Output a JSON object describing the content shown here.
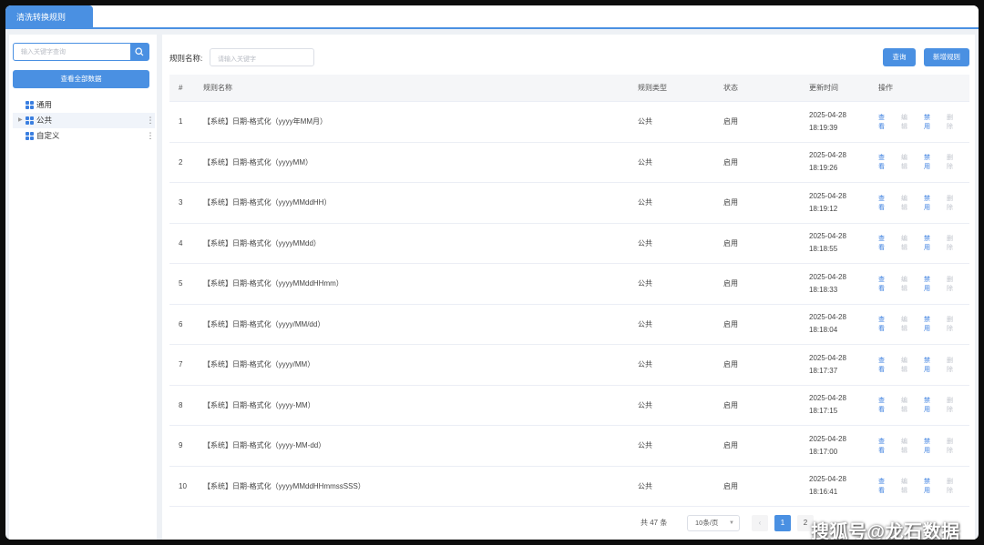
{
  "tab": {
    "title": "清洗转换规则"
  },
  "sidebar": {
    "search_placeholder": "输入关键字查询",
    "view_all_label": "查看全部数据",
    "tree": [
      {
        "label": "通用",
        "has_arrow": false,
        "has_menu": false
      },
      {
        "label": "公共",
        "has_arrow": true,
        "has_menu": true
      },
      {
        "label": "自定义",
        "has_arrow": false,
        "has_menu": true
      }
    ]
  },
  "filter": {
    "label": "规则名称:",
    "placeholder": "请输入关键字",
    "query_label": "查询",
    "add_label": "新增规则"
  },
  "table": {
    "headers": [
      "#",
      "规则名称",
      "规则类型",
      "状态",
      "更新时间",
      "操作"
    ],
    "ops": [
      "查看",
      "编辑",
      "禁用",
      "删除"
    ],
    "rows": [
      {
        "idx": "1",
        "name": "【系统】日期-格式化（yyyy年MM月）",
        "type": "公共",
        "status": "启用",
        "date": "2025-04-28",
        "time": "18:19:39"
      },
      {
        "idx": "2",
        "name": "【系统】日期-格式化（yyyyMM）",
        "type": "公共",
        "status": "启用",
        "date": "2025-04-28",
        "time": "18:19:26"
      },
      {
        "idx": "3",
        "name": "【系统】日期-格式化（yyyyMMddHH）",
        "type": "公共",
        "status": "启用",
        "date": "2025-04-28",
        "time": "18:19:12"
      },
      {
        "idx": "4",
        "name": "【系统】日期-格式化（yyyyMMdd）",
        "type": "公共",
        "status": "启用",
        "date": "2025-04-28",
        "time": "18:18:55"
      },
      {
        "idx": "5",
        "name": "【系统】日期-格式化（yyyyMMddHHmm）",
        "type": "公共",
        "status": "启用",
        "date": "2025-04-28",
        "time": "18:18:33"
      },
      {
        "idx": "6",
        "name": "【系统】日期-格式化（yyyy/MM/dd）",
        "type": "公共",
        "status": "启用",
        "date": "2025-04-28",
        "time": "18:18:04"
      },
      {
        "idx": "7",
        "name": "【系统】日期-格式化（yyyy/MM）",
        "type": "公共",
        "status": "启用",
        "date": "2025-04-28",
        "time": "18:17:37"
      },
      {
        "idx": "8",
        "name": "【系统】日期-格式化（yyyy-MM）",
        "type": "公共",
        "status": "启用",
        "date": "2025-04-28",
        "time": "18:17:15"
      },
      {
        "idx": "9",
        "name": "【系统】日期-格式化（yyyy-MM-dd）",
        "type": "公共",
        "status": "启用",
        "date": "2025-04-28",
        "time": "18:17:00"
      },
      {
        "idx": "10",
        "name": "【系统】日期-格式化（yyyyMMddHHmmssSSS）",
        "type": "公共",
        "status": "启用",
        "date": "2025-04-28",
        "time": "18:16:41"
      }
    ]
  },
  "pager": {
    "total": "共 47 条",
    "page_size": "10条/页",
    "pages": [
      "1",
      "2"
    ]
  },
  "watermark": "搜狐号@龙石数据",
  "colors": {
    "accent": "#4a90e2",
    "link": "#3b7fe0",
    "disabled": "#c0c4cc"
  }
}
